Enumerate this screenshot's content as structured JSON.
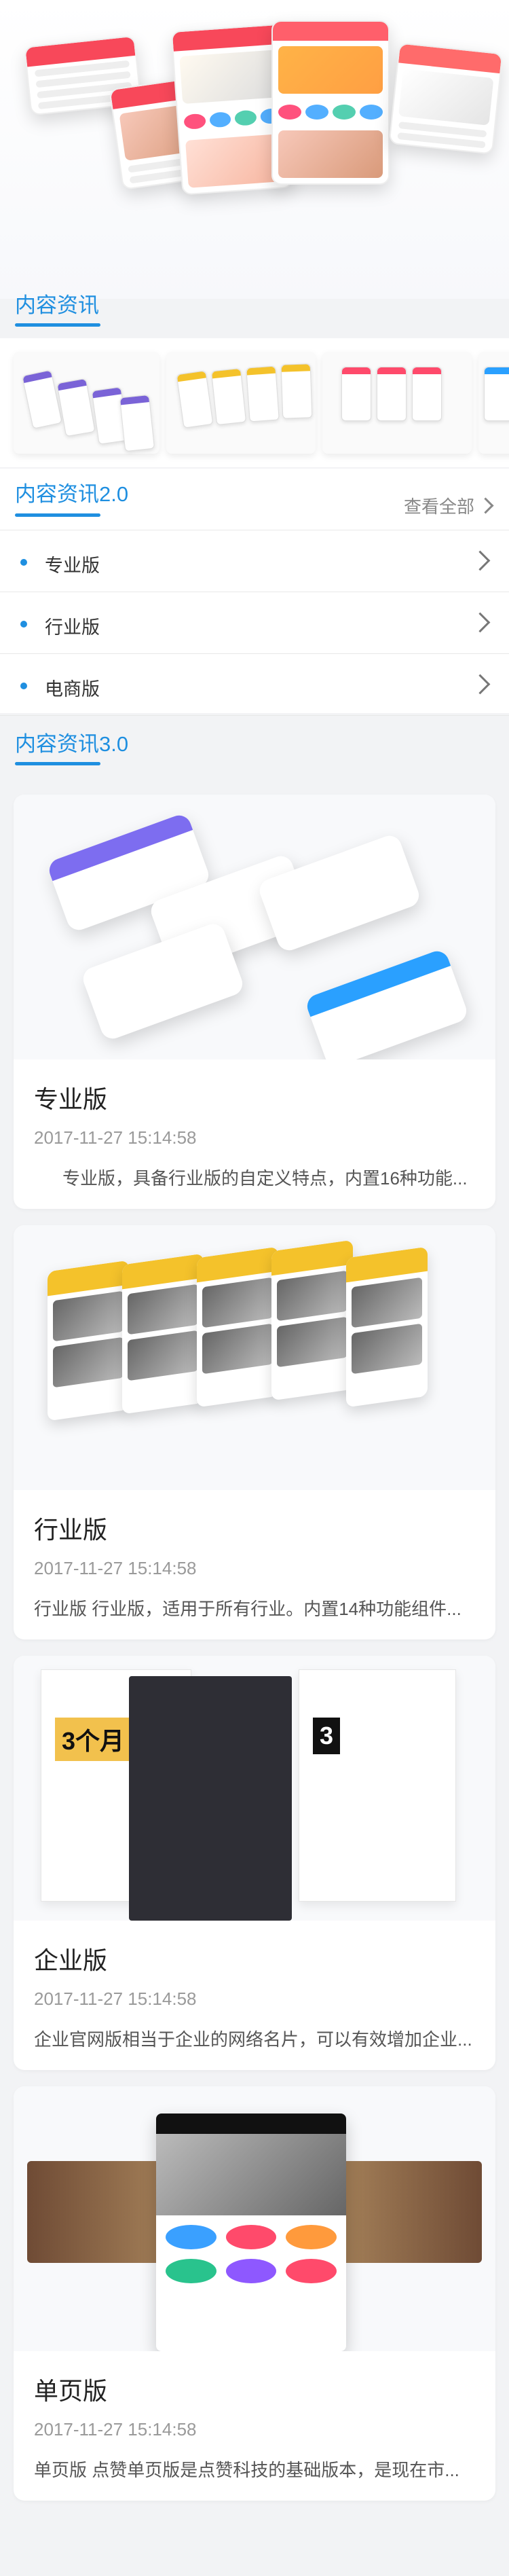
{
  "section_1": {
    "title": "内容资讯"
  },
  "section_2": {
    "title": "内容资讯2.0",
    "view_all": "查看全部",
    "items": [
      {
        "label": "专业版"
      },
      {
        "label": "行业版"
      },
      {
        "label": "电商版"
      }
    ]
  },
  "section_3": {
    "title": "内容资讯3.0",
    "cards": [
      {
        "title": "专业版",
        "time": "2017-11-27 15:14:58",
        "desc": "专业版，具备行业版的自定义特点，内置16种功能..."
      },
      {
        "title": "行业版",
        "time": "2017-11-27 15:14:58",
        "desc": "行业版 行业版，适用于所有行业。内置14种功能组件..."
      },
      {
        "title": "企业版",
        "time": "2017-11-27 15:14:58",
        "desc": "企业官网版相当于企业的网络名片，可以有效增加企业..."
      },
      {
        "title": "单页版",
        "time": "2017-11-27 15:14:58",
        "desc": "单页版 点赞单页版是点赞科技的基础版本，是现在市..."
      }
    ]
  },
  "colors": {
    "accent": "#1f8fe0",
    "background": "#f2f3f5"
  },
  "icons": {
    "chevron": "chevron-right-icon",
    "bullet": "dot-icon"
  }
}
